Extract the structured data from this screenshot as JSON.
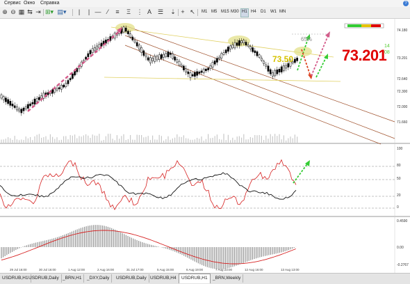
{
  "menu": {
    "items": [
      "Сервис",
      "Окно",
      "Справка"
    ]
  },
  "toolbar": {
    "timeframes": [
      "M1",
      "M5",
      "M15",
      "M30",
      "H1",
      "H4",
      "D1",
      "W1",
      "MN"
    ],
    "active_timeframe": "H1"
  },
  "chart": {
    "current_price": "73.201",
    "level_label": "73.50",
    "percent_label": "65%",
    "mini_values": [
      "14",
      "08"
    ],
    "x_labels": [
      "29 Jul 16:00",
      "30 Jul 16:00",
      "1 Aug 12:00",
      "2 Aug 16:00",
      "31 Jul 17:00",
      "5 Aug 15:00",
      "6 Aug 19:00",
      "7 Aug 23:00",
      "12 Aug 16:00",
      "13 Aug 13:00"
    ],
    "y_labels_main": [
      "74.180",
      "73.201",
      "72.640",
      "72.300",
      "72.000",
      "71.660"
    ],
    "y_labels_osc": [
      "100",
      "80",
      "50",
      "20",
      "0"
    ],
    "y_labels_macd": [
      "0.4590",
      "0.00",
      "-0.2767"
    ],
    "colors": {
      "price_red": "#e00000",
      "level_yellow": "#d6c200",
      "arrow_green": "#33cc33",
      "channel_brown": "#a0522d"
    }
  },
  "tabs": {
    "items": [
      "USDRUB,H1",
      "USDRUB,Daily",
      "_BRN,H1",
      "_DXY,Daily",
      "USDRUB,Daily",
      "USDRUB,H4",
      "USDRUB,H1",
      "_BRN,Weekly"
    ],
    "active_index": 6
  }
}
